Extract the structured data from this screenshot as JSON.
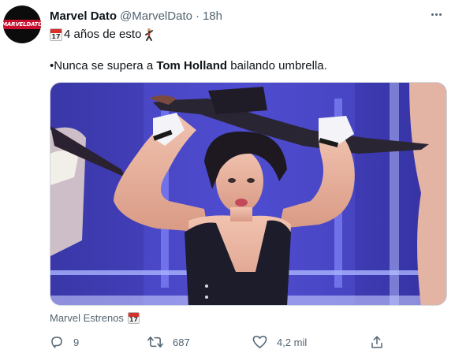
{
  "tweet": {
    "author": {
      "display_name": "Marvel Dato",
      "handle": "@MarvelDato",
      "avatar_text_1": "MARVEL",
      "avatar_text_2": "DATO",
      "avatar_colors": {
        "background": "#0c0c0c",
        "logo": "#c8102e"
      }
    },
    "separator": "·",
    "time": "18h",
    "text_line1": {
      "cal_icon_number": "17",
      "text": "4 años de esto"
    },
    "text_line2": {
      "before": "•Nunca se supera a ",
      "bold": "Tom Holland",
      "after": " bailando umbrella."
    },
    "media": {
      "description_icon": "video-still-icon"
    },
    "media_caption": "Marvel Estrenos",
    "actions": {
      "reply_count": "9",
      "retweet_count": "687",
      "like_count": "4,2 mil"
    }
  },
  "colors": {
    "text_primary": "#0f1419",
    "text_secondary": "#536471",
    "border": "#cfd9de"
  }
}
